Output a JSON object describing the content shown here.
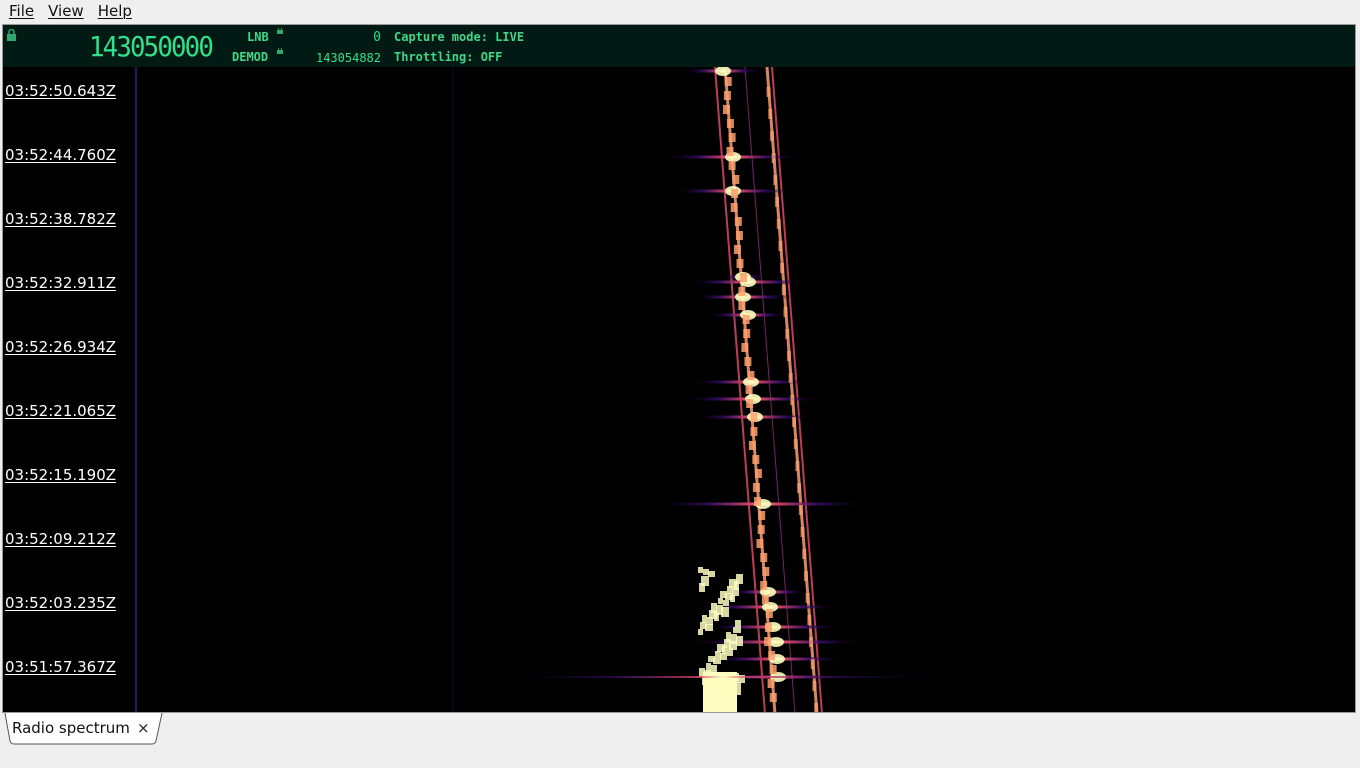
{
  "menu": {
    "file": "File",
    "view": "View",
    "help": "Help"
  },
  "status": {
    "main_frequency": "143050000",
    "lnb_label": "LNB",
    "lnb_value": "0",
    "demod_label": "DEMOD",
    "demod_value": "143054882",
    "capture_mode": "Capture mode: LIVE",
    "throttling": "Throttling: OFF",
    "accent_color": "#2fe08c"
  },
  "waterfall": {
    "timestamps": [
      "03:52:50.643Z",
      "03:52:44.760Z",
      "03:52:38.782Z",
      "03:52:32.911Z",
      "03:52:26.934Z",
      "03:52:21.065Z",
      "03:52:15.190Z",
      "03:52:09.212Z",
      "03:52:03.235Z",
      "03:51:57.367Z"
    ],
    "colormap": [
      "#000000",
      "#3b0f70",
      "#8c2981",
      "#de4968",
      "#fe9f6d",
      "#fcfdbf"
    ]
  },
  "tabs": [
    {
      "label": "Radio spectrum",
      "close": "×"
    }
  ]
}
